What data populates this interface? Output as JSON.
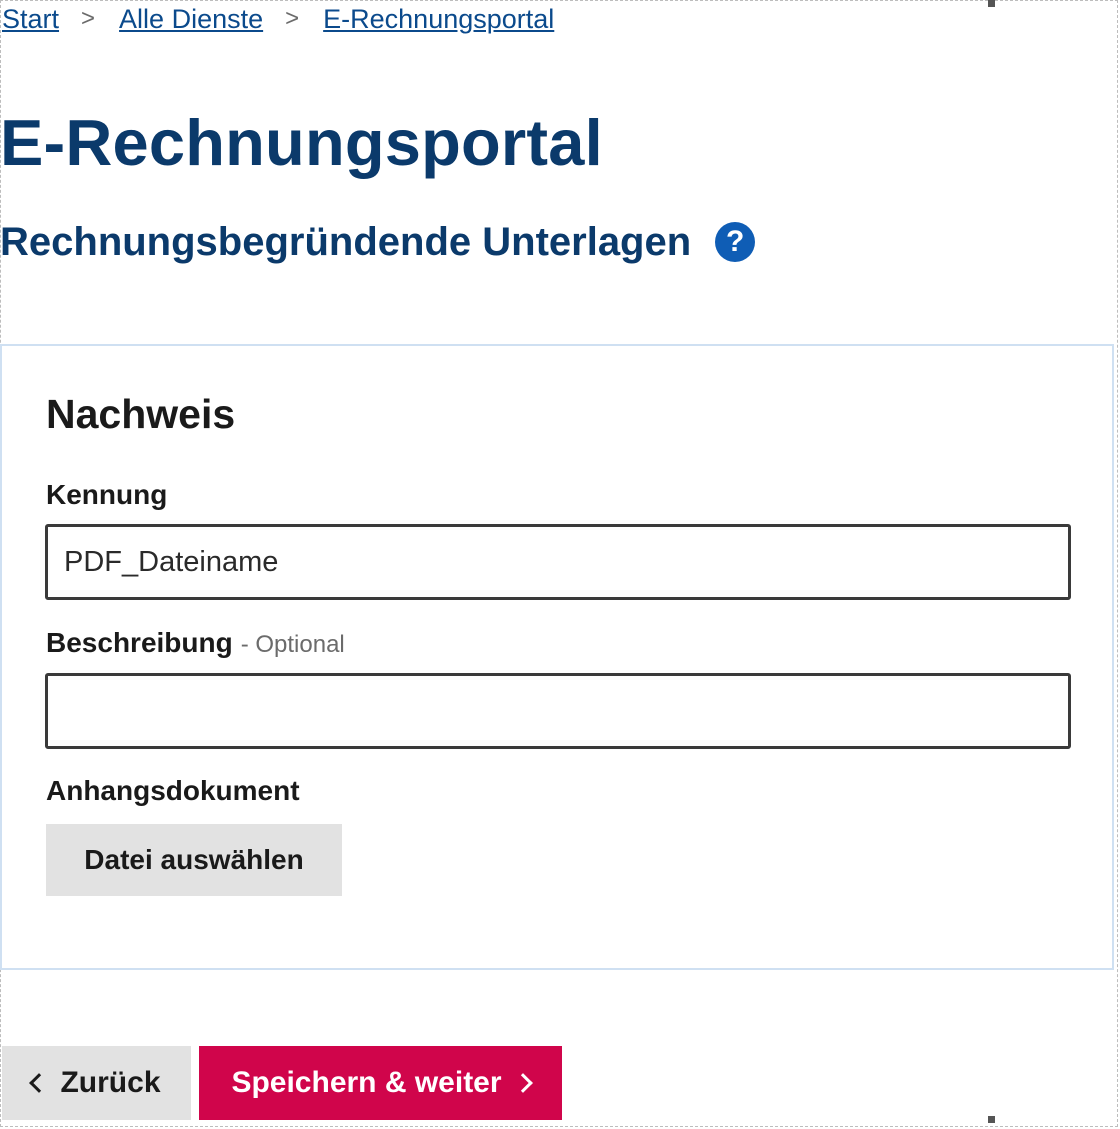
{
  "breadcrumb": {
    "items": [
      "Start",
      "Alle Dienste",
      "E-Rechnungsportal"
    ],
    "separator": ">"
  },
  "page": {
    "title": "E-Rechnungsportal",
    "section_heading": "Rechnungsbegründende Unterlagen",
    "help_icon_glyph": "?"
  },
  "card": {
    "title": "Nachweis",
    "fields": {
      "kennung": {
        "label": "Kennung",
        "value": "PDF_Dateiname"
      },
      "beschreibung": {
        "label": "Beschreibung",
        "optional_hint": "- Optional",
        "value": ""
      },
      "anhang": {
        "label": "Anhangsdokument",
        "button_label": "Datei auswählen"
      }
    }
  },
  "actions": {
    "back_label": "Zurück",
    "primary_label": "Speichern & weiter"
  },
  "colors": {
    "heading_blue": "#0b3a6b",
    "link_blue": "#0b4a8c",
    "help_icon_blue": "#0f5db5",
    "primary_button": "#d0054b",
    "secondary_button": "#e2e2e2",
    "card_border": "#cfe0f2"
  },
  "icons": {
    "help": "question-circle-icon",
    "back": "chevron-left-icon",
    "forward": "chevron-right-icon"
  }
}
